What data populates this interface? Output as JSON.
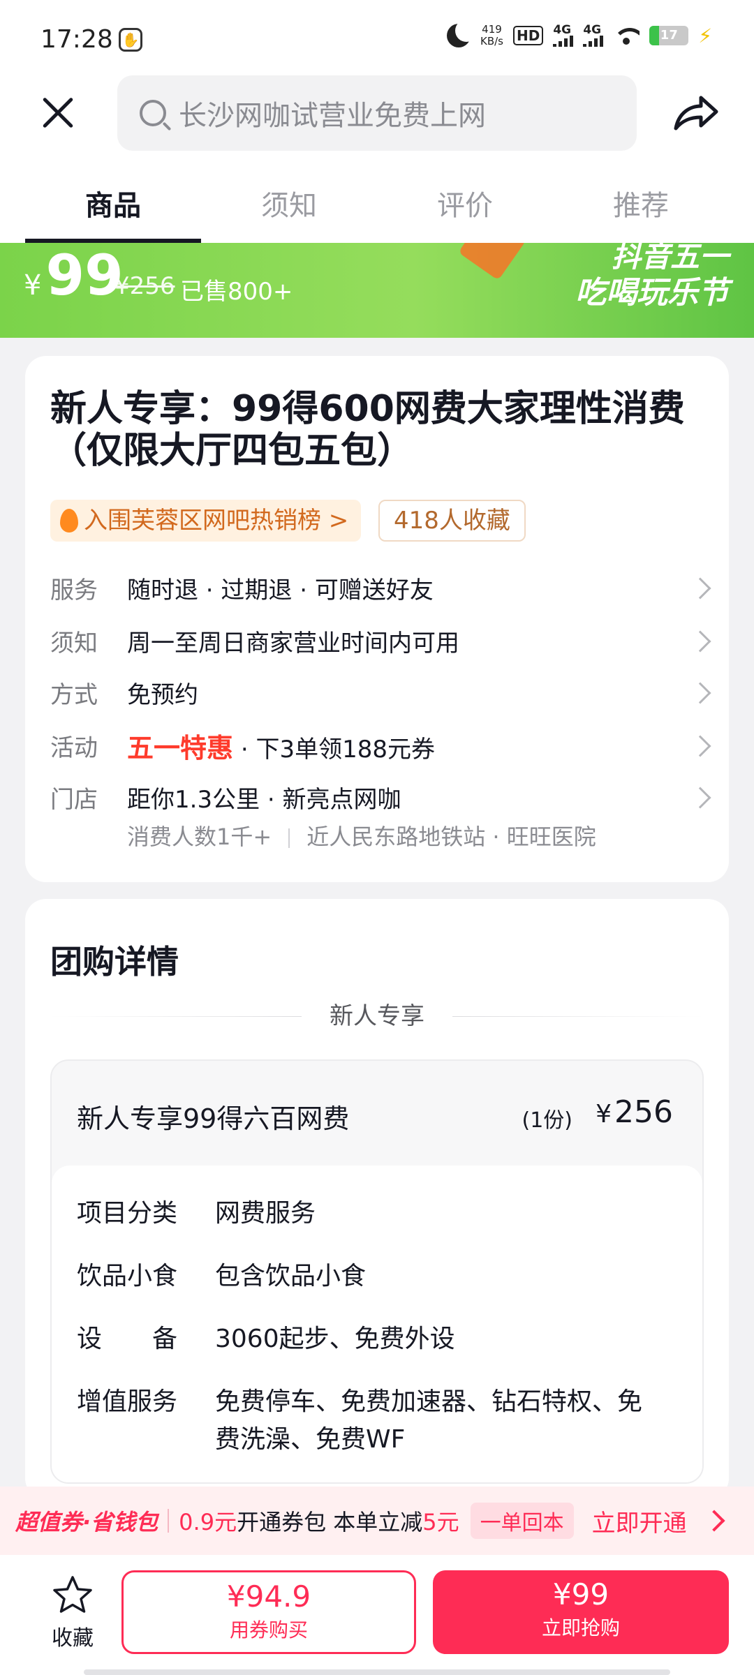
{
  "status_bar": {
    "time": "17:28",
    "speed_value": "419",
    "speed_unit": "KB/s",
    "hd": "HD",
    "net1": "4G",
    "net2": "4G",
    "battery": "17"
  },
  "header": {
    "search_text": "长沙网咖试营业免费上网"
  },
  "tabs": [
    "商品",
    "须知",
    "评价",
    "推荐"
  ],
  "banner": {
    "currency": "¥",
    "price": "99",
    "original_price": "¥256",
    "sold": "已售800+",
    "promo_line1": "抖音五一",
    "promo_line2": "吃喝玩乐节"
  },
  "product": {
    "title": "新人专享：99得600网费大家理性消费（仅限大厅四包五包）",
    "rank_tag": "入围芙蓉区网吧热销榜 >",
    "fav_tag": "418人收藏",
    "rows": [
      {
        "label": "服务",
        "value": "随时退 · 过期退  ·  可赠送好友"
      },
      {
        "label": "须知",
        "value": "周一至周日商家营业时间内可用"
      },
      {
        "label": "方式",
        "value": "免预约"
      },
      {
        "label": "活动",
        "highlight": "五一特惠",
        "value": " ·  下3单领188元券"
      },
      {
        "label": "门店",
        "value": "距你1.3公里  ·  新亮点网咖"
      }
    ],
    "store_consumers": "消费人数1千+",
    "store_location": "近人民东路地铁站 · 旺旺医院"
  },
  "details": {
    "section_title": "团购详情",
    "divider_title": "新人专享",
    "package_name": "新人专享99得六百网费",
    "package_qty": "(1份)",
    "package_currency": "¥",
    "package_price": "256",
    "rows": [
      {
        "key": "项目分类",
        "value": "网费服务"
      },
      {
        "key": "饮品小食",
        "value": "包含饮品小食"
      },
      {
        "key": "设　　备",
        "value": "3060起步、免费外设"
      },
      {
        "key": "增值服务",
        "value": "免费停车、免费加速器、钻石特权、免费洗澡、免费WF"
      }
    ]
  },
  "promo": {
    "brand": "超值券·省钱包",
    "amount": "0.9元",
    "text1": "开通券包 本单立减",
    "save_amount": "5元",
    "badge": "一单回本",
    "link": "立即开通"
  },
  "bottom_bar": {
    "fav_label": "收藏",
    "coupon_price": "¥94.9",
    "coupon_label": "用券购买",
    "buy_price": "¥99",
    "buy_label": "立即抢购"
  },
  "colors": {
    "accent": "#fe2c55",
    "banner_green": "#7bd34a",
    "activity_red": "#fe3b2c"
  }
}
